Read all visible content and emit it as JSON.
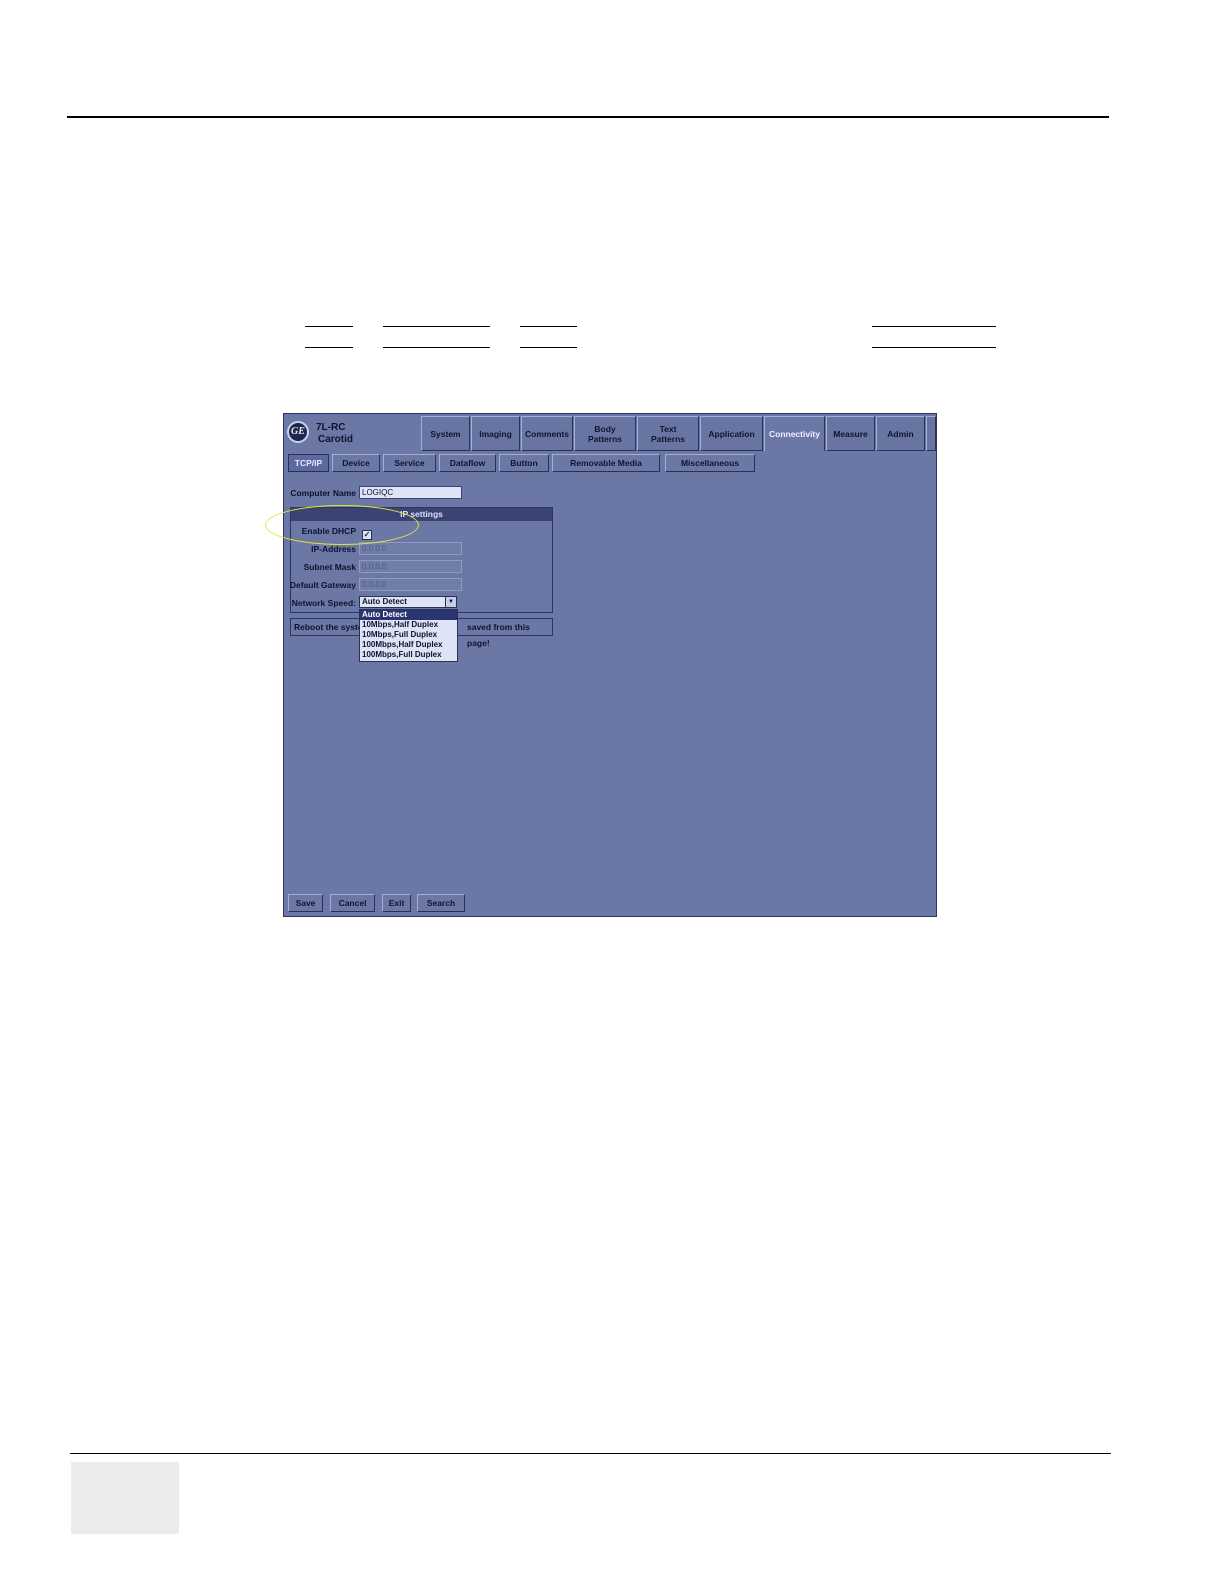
{
  "screen": {
    "probe": {
      "line1": "7L-RC",
      "line2": "Carotid"
    },
    "top_tabs": [
      {
        "label": "System"
      },
      {
        "label": "Imaging"
      },
      {
        "label": "Comments"
      },
      {
        "label": "Body Patterns"
      },
      {
        "label": "Text Patterns"
      },
      {
        "label": "Application"
      },
      {
        "label": "Connectivity",
        "active": true
      },
      {
        "label": "Measure"
      },
      {
        "label": "Admin"
      }
    ],
    "sub_tabs": [
      {
        "label": "TCP/IP",
        "active": true
      },
      {
        "label": "Device"
      },
      {
        "label": "Service"
      },
      {
        "label": "Dataflow"
      },
      {
        "label": "Button"
      },
      {
        "label": "Removable Media"
      },
      {
        "label": "Miscellaneous"
      }
    ],
    "computer_name": {
      "label": "Computer Name",
      "value": "LOGIQC"
    },
    "ip_settings": {
      "title": "IP settings",
      "enable_dhcp_label": "Enable DHCP",
      "enable_dhcp_checked": true,
      "checkmark": "✓",
      "ip_address": {
        "label": "IP-Address",
        "value": "0.0.0.0"
      },
      "subnet_mask": {
        "label": "Subnet Mask",
        "value": "0.0.0.0"
      },
      "default_gateway": {
        "label": "Default Gateway",
        "value": "0.0.0.0"
      },
      "network_speed": {
        "label": "Network Speed:",
        "value": "Auto Detect",
        "options": [
          "Auto Detect",
          "10Mbps,Half Duplex",
          "10Mbps,Full Duplex",
          "100Mbps,Half Duplex",
          "100Mbps,Full Duplex"
        ]
      }
    },
    "status_message": {
      "part1": "Reboot the syste",
      "part2": "saved from this page!"
    },
    "buttons": {
      "save": "Save",
      "cancel": "Cancel",
      "exit": "Exit",
      "search": "Search"
    },
    "highlight_color": "#e4e43a"
  }
}
